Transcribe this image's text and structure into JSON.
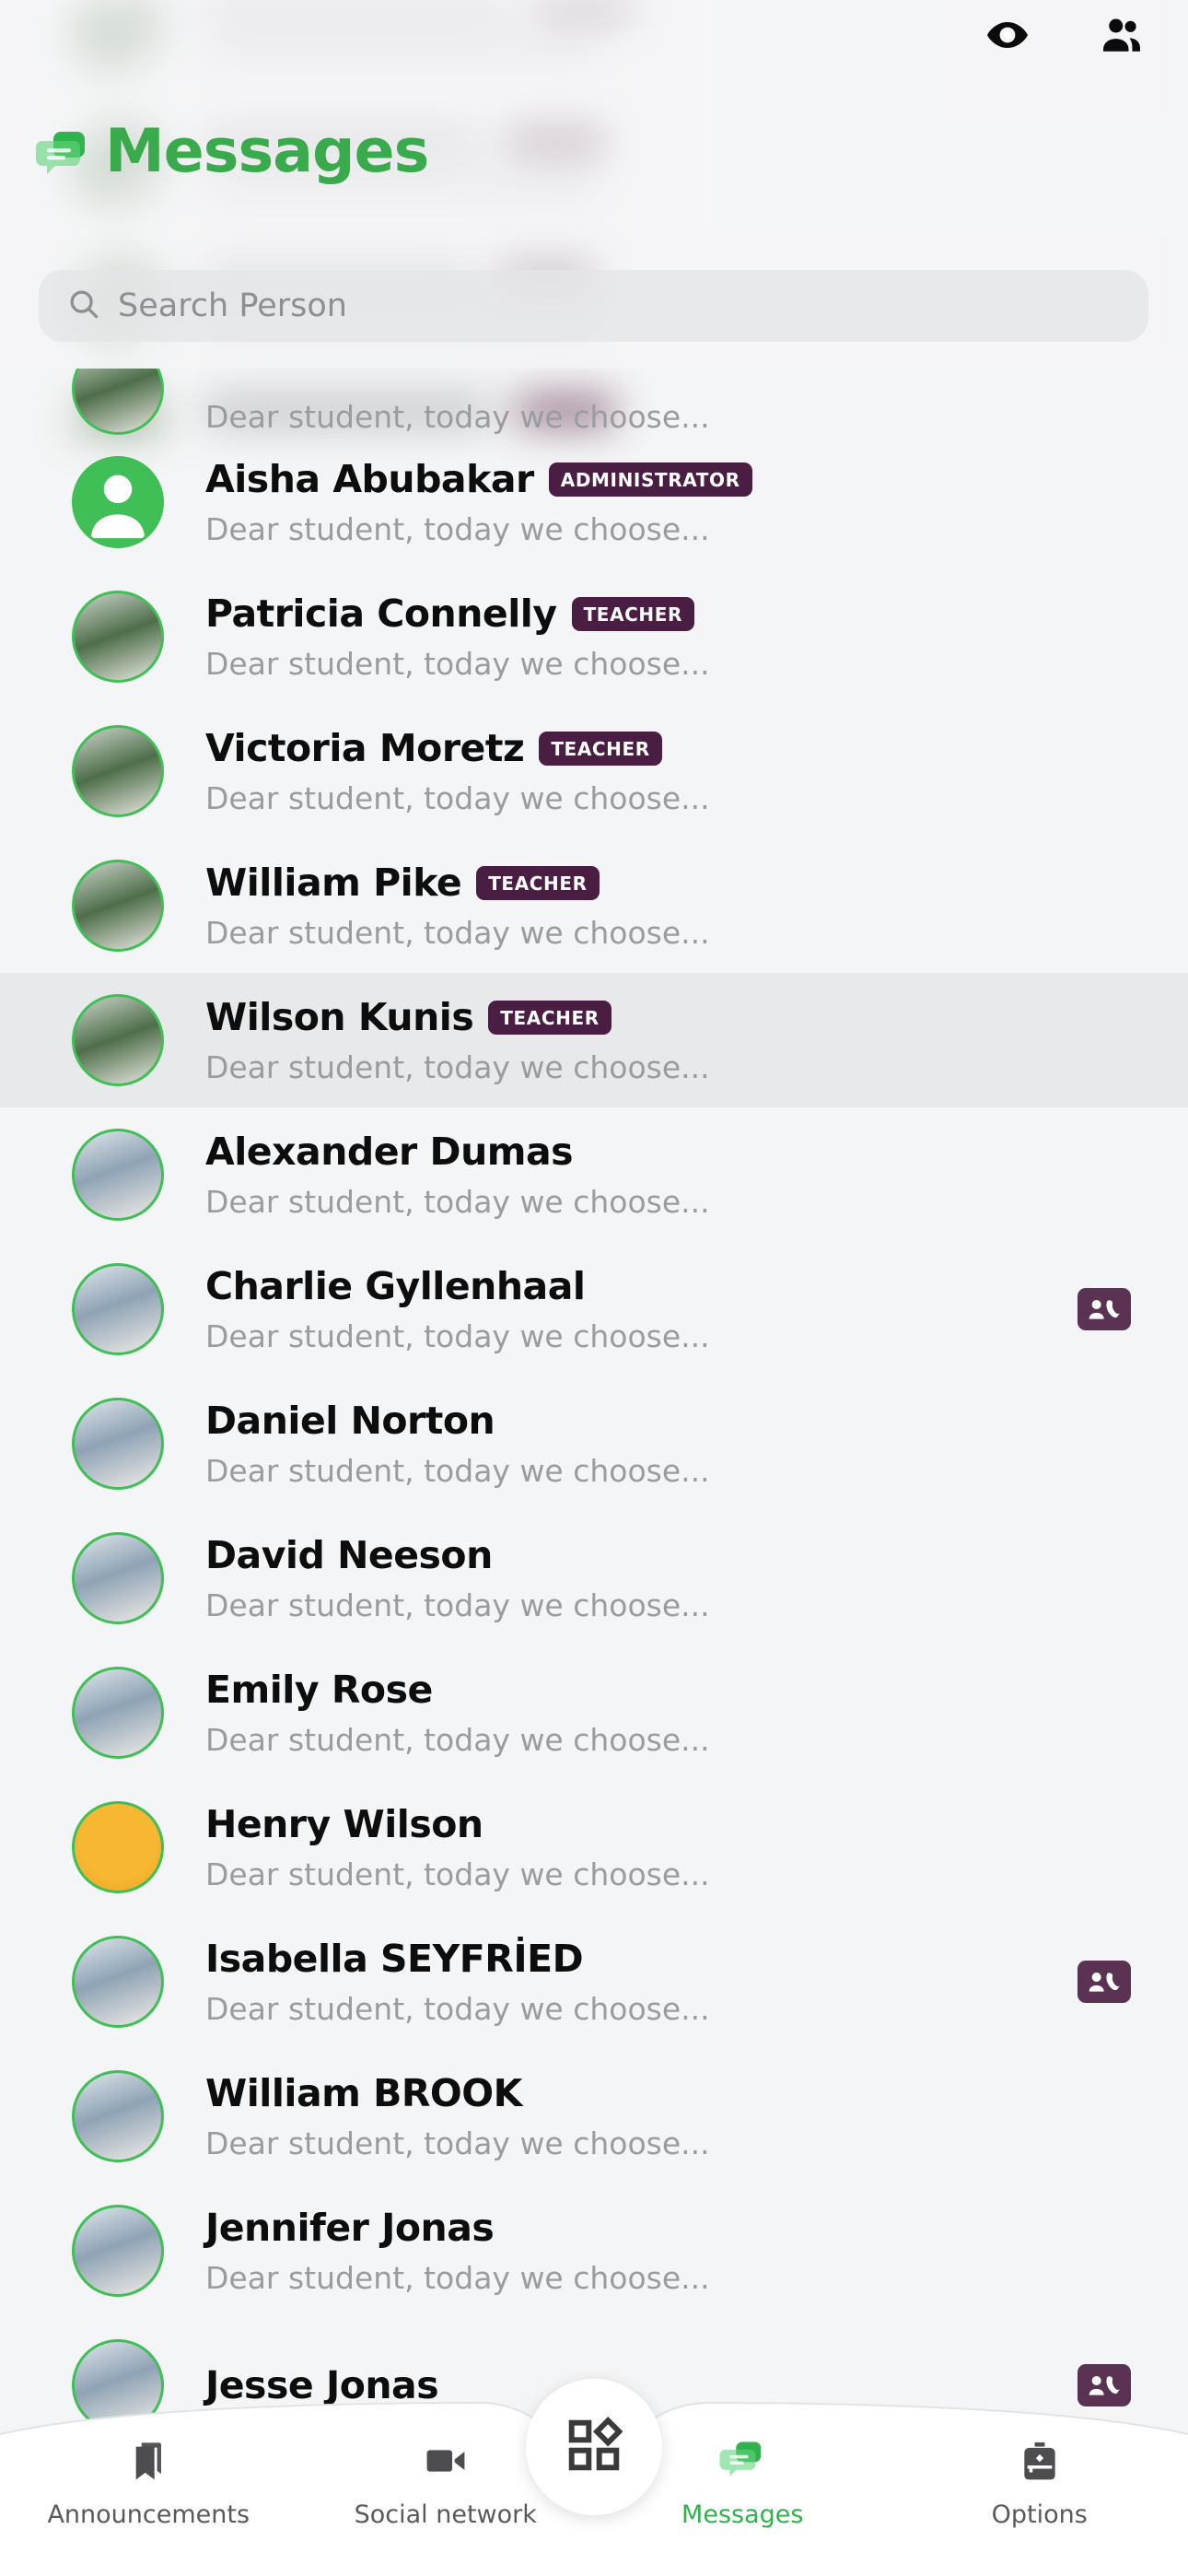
{
  "header": {
    "title": "Messages",
    "logo_icon": "chat-bubbles-icon",
    "eye_icon": "eye-icon",
    "people_icon": "people-group-icon",
    "accent_color": "#39ab4d"
  },
  "search": {
    "placeholder": "Search Person",
    "icon": "search-icon",
    "value": ""
  },
  "list": {
    "preview_text": "Dear student, today we choose...",
    "badge_color": "#4a1e42",
    "selected_name": "Wilson Kunis",
    "contacts": [
      {
        "name": "",
        "badge": "",
        "preview": "Dear student, today we choose...",
        "clipped": true,
        "avatar": "teacher-photo",
        "card_icon": false,
        "selected": false
      },
      {
        "name": "Aisha Abubakar",
        "badge": "ADMINISTRATOR",
        "preview": "Dear student, today we choose...",
        "clipped": false,
        "avatar": "default-person-avatar",
        "card_icon": false,
        "selected": false
      },
      {
        "name": "Patricia Connelly",
        "badge": "TEACHER",
        "preview": "Dear student, today we choose...",
        "clipped": false,
        "avatar": "teacher-photo",
        "card_icon": false,
        "selected": false
      },
      {
        "name": "Victoria Moretz",
        "badge": "TEACHER",
        "preview": "Dear student, today we choose...",
        "clipped": false,
        "avatar": "teacher-photo",
        "card_icon": false,
        "selected": false
      },
      {
        "name": "William Pike",
        "badge": "TEACHER",
        "preview": "Dear student, today we choose...",
        "clipped": false,
        "avatar": "teacher-photo",
        "card_icon": false,
        "selected": false
      },
      {
        "name": "Wilson Kunis",
        "badge": "TEACHER",
        "preview": "Dear student, today we choose...",
        "clipped": false,
        "avatar": "teacher-photo",
        "card_icon": false,
        "selected": true
      },
      {
        "name": "Alexander Dumas",
        "badge": "",
        "preview": "Dear student, today we choose...",
        "clipped": false,
        "avatar": "student-photo",
        "card_icon": false,
        "selected": false
      },
      {
        "name": "Charlie Gyllenhaal",
        "badge": "",
        "preview": "Dear student, today we choose...",
        "clipped": false,
        "avatar": "student-photo",
        "card_icon": true,
        "selected": false
      },
      {
        "name": "Daniel Norton",
        "badge": "",
        "preview": "Dear student, today we choose...",
        "clipped": false,
        "avatar": "student-photo",
        "card_icon": false,
        "selected": false
      },
      {
        "name": "David Neeson",
        "badge": "",
        "preview": "Dear student, today we choose...",
        "clipped": false,
        "avatar": "student-photo",
        "card_icon": false,
        "selected": false
      },
      {
        "name": "Emily Rose",
        "badge": "",
        "preview": "Dear student, today we choose...",
        "clipped": false,
        "avatar": "student-photo",
        "card_icon": false,
        "selected": false
      },
      {
        "name": "Henry Wilson",
        "badge": "",
        "preview": "Dear student, today we choose...",
        "clipped": false,
        "avatar": "student-photo-yellow",
        "card_icon": false,
        "selected": false
      },
      {
        "name": "Isabella SEYFRİED",
        "badge": "",
        "preview": "Dear student, today we choose...",
        "clipped": false,
        "avatar": "student-photo",
        "card_icon": true,
        "selected": false
      },
      {
        "name": "William BROOK",
        "badge": "",
        "preview": "Dear student, today we choose...",
        "clipped": false,
        "avatar": "student-photo",
        "card_icon": false,
        "selected": false
      },
      {
        "name": "Jennifer Jonas",
        "badge": "",
        "preview": "Dear student, today we choose...",
        "clipped": false,
        "avatar": "student-photo",
        "card_icon": false,
        "selected": false
      },
      {
        "name": "Jesse Jonas",
        "badge": "",
        "preview": "",
        "clipped": false,
        "avatar": "student-photo",
        "card_icon": true,
        "selected": false
      }
    ]
  },
  "bottom_nav": {
    "active": "Messages",
    "active_color": "#2eb24c",
    "fab_icon": "apps-grid-icon",
    "items": [
      {
        "label": "Announcements",
        "icon": "bookmark-icon",
        "active": false
      },
      {
        "label": "Social network",
        "icon": "video-camera-icon",
        "active": false
      },
      {
        "label": "Messages",
        "icon": "chat-bubbles-icon",
        "active": true
      },
      {
        "label": "Options",
        "icon": "backpack-icon",
        "active": false
      }
    ]
  }
}
